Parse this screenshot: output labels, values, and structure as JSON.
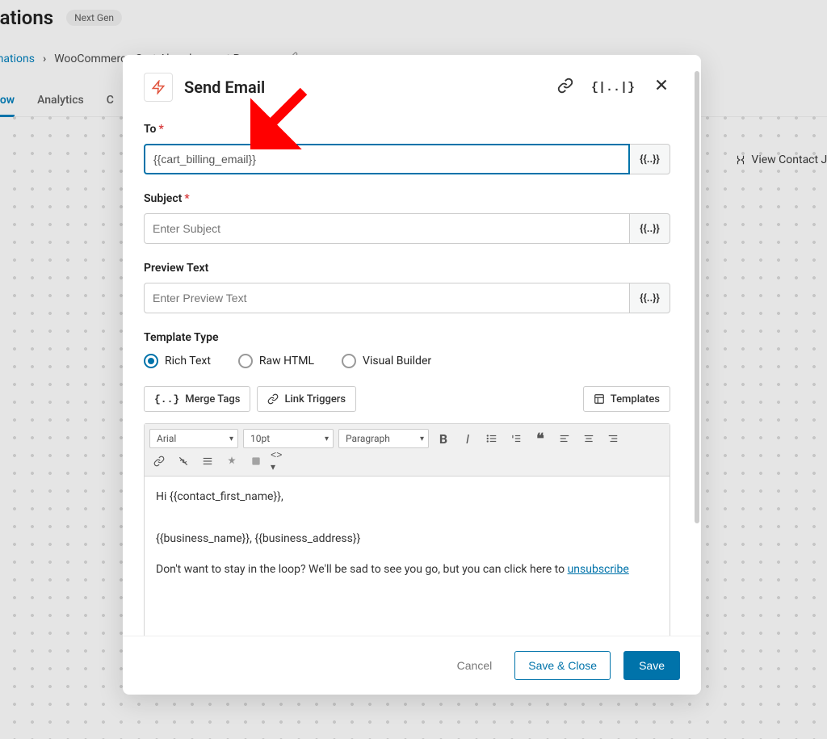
{
  "page": {
    "title": "utomations",
    "badge": "Next Gen",
    "breadcrumb_root": "utomations",
    "breadcrumb_current": "WooCommerce Cart Abandonment Recovery",
    "tabs": {
      "workflow": "kflow",
      "analytics": "Analytics",
      "other": "C"
    },
    "journey_link": "View Contact Jou"
  },
  "modal": {
    "title": "Send Email",
    "fields": {
      "to": {
        "label": "To",
        "value": "{{cart_billing_email}}"
      },
      "subject": {
        "label": "Subject",
        "placeholder": "Enter Subject"
      },
      "preview": {
        "label": "Preview Text",
        "placeholder": "Enter Preview Text"
      },
      "template_type": {
        "label": "Template Type",
        "options": {
          "rich": "Rich Text",
          "raw": "Raw HTML",
          "visual": "Visual Builder"
        }
      }
    },
    "tool_buttons": {
      "merge_tags": "Merge Tags",
      "link_triggers": "Link Triggers",
      "templates": "Templates"
    },
    "editor_toolbar": {
      "font": "Arial",
      "size": "10pt",
      "para": "Paragraph"
    },
    "editor_body": {
      "line1": "Hi {{contact_first_name}},",
      "line2": "{{business_name}}, {{business_address}}",
      "line3_pre": "Don't want to stay in the loop? We'll be sad to see you go, but you can click here to ",
      "line3_link": "unsubscribe"
    },
    "footer": {
      "cancel": "Cancel",
      "save_close": "Save & Close",
      "save": "Save"
    }
  }
}
